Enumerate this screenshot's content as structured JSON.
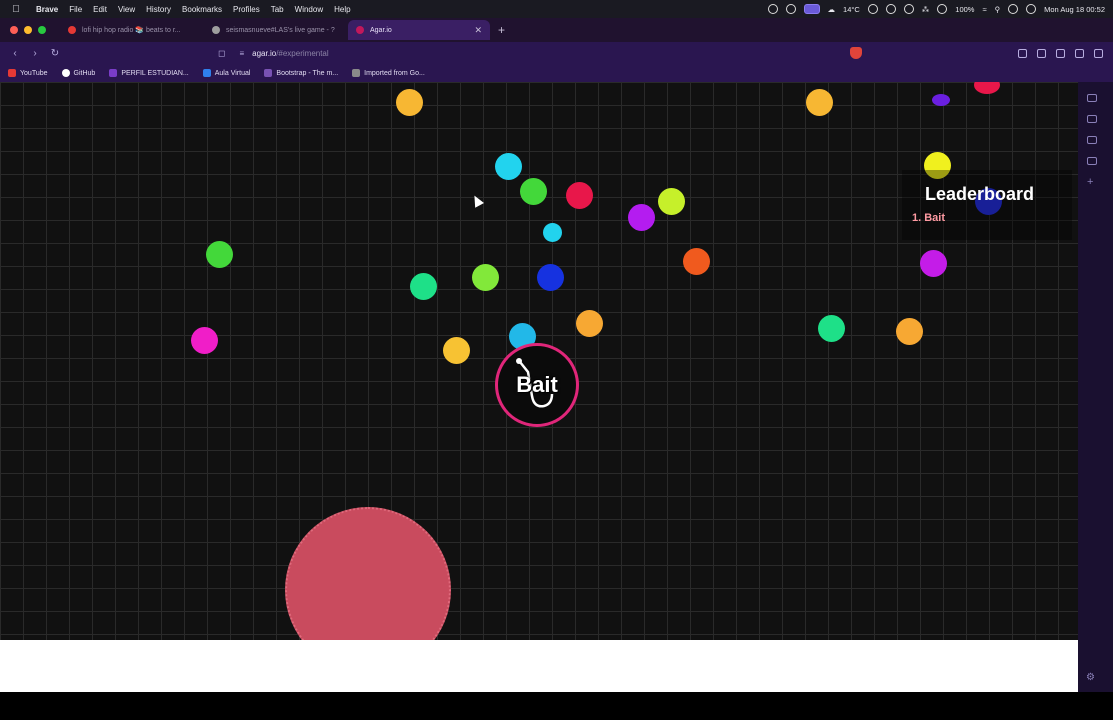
{
  "menubar": {
    "app_name": "Brave",
    "menus": [
      "File",
      "Edit",
      "View",
      "History",
      "Bookmarks",
      "Profiles",
      "Tab",
      "Window",
      "Help"
    ],
    "weather": "14°C",
    "battery": "100%",
    "datetime": "Mon Aug 18  00:52"
  },
  "tabs": [
    {
      "label": "lofi hip hop radio 📚 beats to r...",
      "favicon_color": "#e53935",
      "active": false
    },
    {
      "label": "seismasnueve#LAS's live game - ?",
      "favicon_color": "#9e9e9e",
      "active": false
    },
    {
      "label": "Agar.io",
      "favicon_color": "#c2185b",
      "active": true
    }
  ],
  "address_bar": {
    "host": "agar.io",
    "path": "/#experimental"
  },
  "bookmarks": [
    {
      "label": "YouTube",
      "icon_color": "#e53935"
    },
    {
      "label": "GitHub",
      "icon_color": "#ffffff"
    },
    {
      "label": "PERFIL ESTUDIAN...",
      "icon_color": "#7a3cc8"
    },
    {
      "label": "Aula Virtual",
      "icon_color": "#2f80ed"
    },
    {
      "label": "Bootstrap - The m...",
      "icon_color": "#7952b3"
    },
    {
      "label": "Imported from Go...",
      "icon_color": "#8a8a8a"
    }
  ],
  "game": {
    "player_name": "Bait",
    "player_border_color": "#e0267a",
    "virus_color": "#c94b5e",
    "leaderboard": {
      "title": "Leaderboard",
      "entries": [
        "1. Bait"
      ]
    }
  },
  "colors": {
    "chrome_bg": "#2a1650",
    "grid_line": "#2a2a2a",
    "game_bg": "#111111"
  }
}
